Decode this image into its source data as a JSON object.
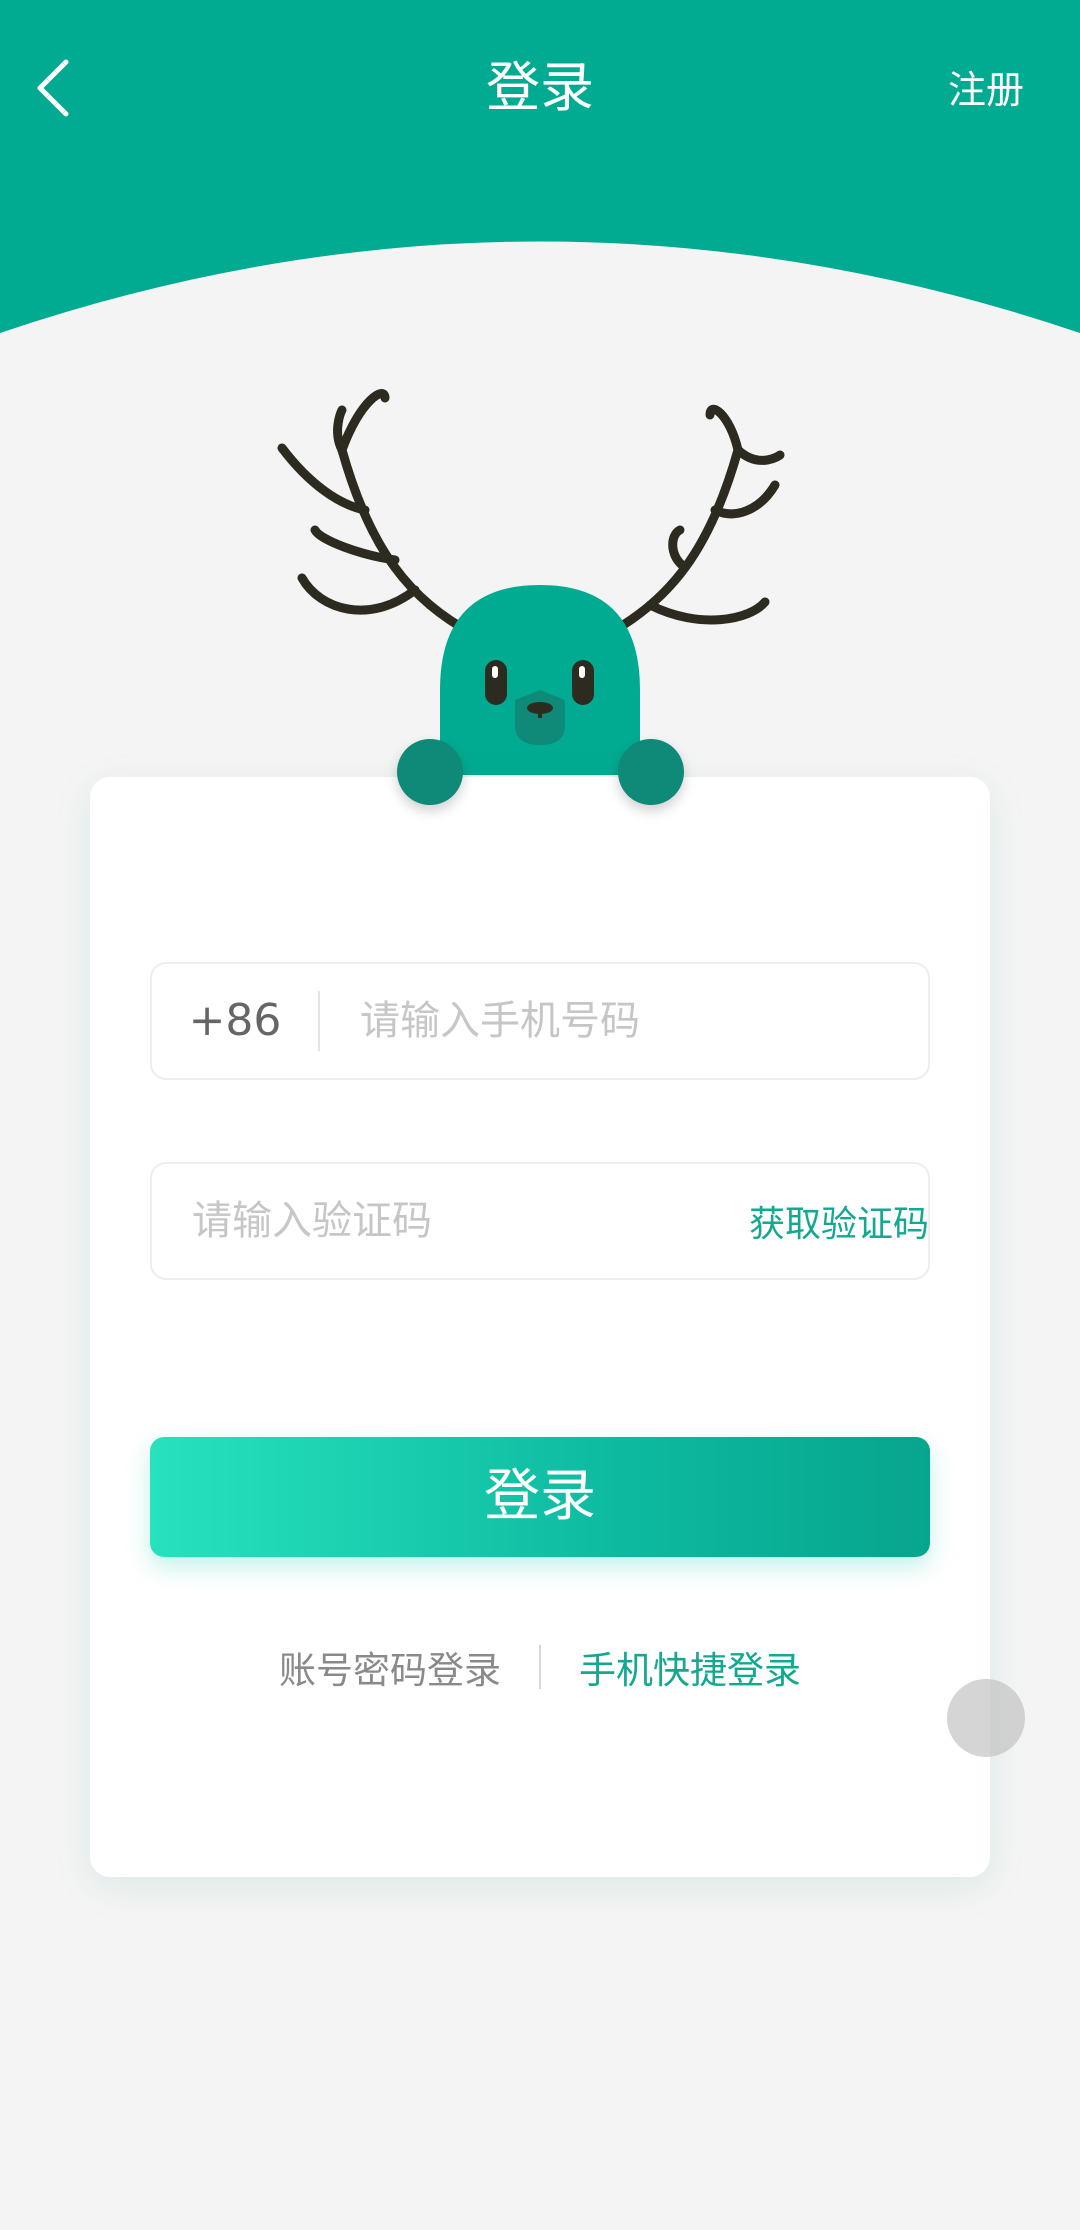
{
  "header": {
    "title": "登录",
    "register_label": "注册",
    "back_icon": "chevron-left-icon"
  },
  "colors": {
    "primary": "#00ab91",
    "accent_text": "#13a890",
    "paw": "#0f8a78",
    "antler": "#2d2a1f",
    "page_bg": "#f4f4f4"
  },
  "mascot": {
    "icon": "deer-mascot-icon"
  },
  "form": {
    "country_code": "+86",
    "phone_placeholder": "请输入手机号码",
    "phone_value": "",
    "code_placeholder": "请输入验证码",
    "code_value": "",
    "get_code_label": "获取验证码",
    "login_label": "登录"
  },
  "login_switch": {
    "password_login": "账号密码登录",
    "quick_login": "手机快捷登录",
    "active": "quick_login"
  },
  "floating_button": {
    "icon": "assistive-touch-icon"
  }
}
